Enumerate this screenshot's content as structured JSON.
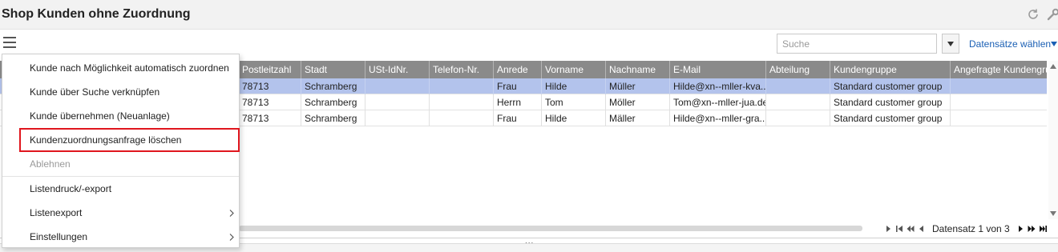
{
  "window": {
    "title": "Shop Kunden ohne Zuordnung",
    "icons": [
      "refresh-icon",
      "wrench-icon"
    ]
  },
  "toolbar": {
    "menu_icon": "hamburger-icon",
    "search_placeholder": "Suche",
    "search_value": "",
    "filter_icon": "triangle-down-icon",
    "select_records_label": "Datensätze wählen"
  },
  "grid": {
    "columns": [
      "Postleitzahl",
      "Stadt",
      "USt-IdNr.",
      "Telefon-Nr.",
      "Anrede",
      "Vorname",
      "Nachname",
      "E-Mail",
      "Abteilung",
      "Kundengruppe",
      "Angefragte Kundengrup"
    ],
    "rows": [
      [
        "78713",
        "Schramberg",
        "",
        "",
        "Frau",
        "Hilde",
        "Müller",
        "Hilde@xn--mller-kva...",
        "",
        "Standard customer group",
        ""
      ],
      [
        "78713",
        "Schramberg",
        "",
        "",
        "Herrn",
        "Tom",
        "Möller",
        "Tom@xn--mller-jua.de",
        "",
        "Standard customer group",
        ""
      ],
      [
        "78713",
        "Schramberg",
        "",
        "",
        "Frau",
        "Hilde",
        "Mäller",
        "Hilde@xn--mller-gra...",
        "",
        "Standard customer group",
        ""
      ]
    ],
    "selected_row": 0
  },
  "pager": {
    "record_text": "Datensatz 1 von 3"
  },
  "splitter_text": "...",
  "menu": {
    "items": [
      {
        "label": "Kunde nach Möglichkeit automatisch zuordnen",
        "enabled": true,
        "submenu": false
      },
      {
        "label": "Kunde über Suche verknüpfen",
        "enabled": true,
        "submenu": false
      },
      {
        "label": "Kunde übernehmen (Neuanlage)",
        "enabled": true,
        "submenu": false
      },
      {
        "label": "Kundenzuordnungsanfrage löschen",
        "enabled": true,
        "submenu": false,
        "highlighted": true
      },
      {
        "label": "Ablehnen",
        "enabled": false,
        "submenu": false
      },
      {
        "label": "Listendruck/-export",
        "enabled": true,
        "submenu": false
      },
      {
        "label": "Listenexport",
        "enabled": true,
        "submenu": true
      },
      {
        "label": "Einstellungen",
        "enabled": true,
        "submenu": true
      }
    ]
  },
  "colors": {
    "header_bg": "#8a8a8a",
    "selected_row": "#b3c3ec",
    "link": "#1a5fb4",
    "highlight_border": "#e0161e"
  }
}
